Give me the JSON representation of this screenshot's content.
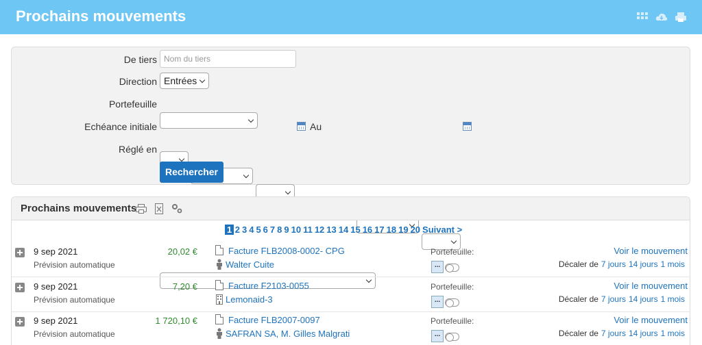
{
  "header": {
    "title": "Prochains mouvements"
  },
  "filters": {
    "tiers_label": "De tiers",
    "tiers_placeholder": "Nom du tiers",
    "direction_label": "Direction",
    "direction_value": "Entrées",
    "portefeuille_label": "Portefeuille",
    "echeance_label": "Echéance initiale",
    "au_label": "Au",
    "regle_label": "Réglé en",
    "search_button": "Rechercher"
  },
  "panel": {
    "title": "Prochains mouvements"
  },
  "pagination": {
    "pages": [
      "1",
      "2",
      "3",
      "4",
      "5",
      "6",
      "7",
      "8",
      "9",
      "10",
      "11",
      "12",
      "13",
      "14",
      "15",
      "16",
      "17",
      "18",
      "19",
      "20"
    ],
    "current": "1",
    "next": "Suivant >"
  },
  "rows": [
    {
      "date": "9 sep 2021",
      "subtitle": "Prévision automatique",
      "amount": "20,02 €",
      "invoice": "Facture FLB2008-0002- CPG",
      "party": "Walter Cuite",
      "party_icon": "person-icon",
      "portefeuille": "Portefeuille:",
      "dots": "...",
      "voir": "Voir le mouvement",
      "decaler": "Décaler de",
      "d1": "7 jours",
      "d2": "14 jours",
      "d3": "1 mois"
    },
    {
      "date": "9 sep 2021",
      "subtitle": "Prévision automatique",
      "amount": "7,20 €",
      "invoice": "Facture F2103-0055",
      "party": "Lemonaid-3",
      "party_icon": "building-icon",
      "portefeuille": "Portefeuille:",
      "dots": "...",
      "voir": "Voir le mouvement",
      "decaler": "Décaler de",
      "d1": "7 jours",
      "d2": "14 jours",
      "d3": "1 mois"
    },
    {
      "date": "9 sep 2021",
      "subtitle": "Prévision automatique",
      "amount": "1 720,10 €",
      "invoice": "Facture FLB2007-0097",
      "party": "SAFRAN SA, M. Gilles Malgrati",
      "party_icon": "person-icon",
      "portefeuille": "Portefeuille:",
      "dots": "...",
      "voir": "Voir le mouvement",
      "decaler": "Décaler de",
      "d1": "7 jours",
      "d2": "14 jours",
      "d3": "1 mois"
    }
  ],
  "colors": {
    "header_bg": "#6ec6f5",
    "link": "#1e73be",
    "amount": "#2e8b2e",
    "button": "#1e73be"
  }
}
